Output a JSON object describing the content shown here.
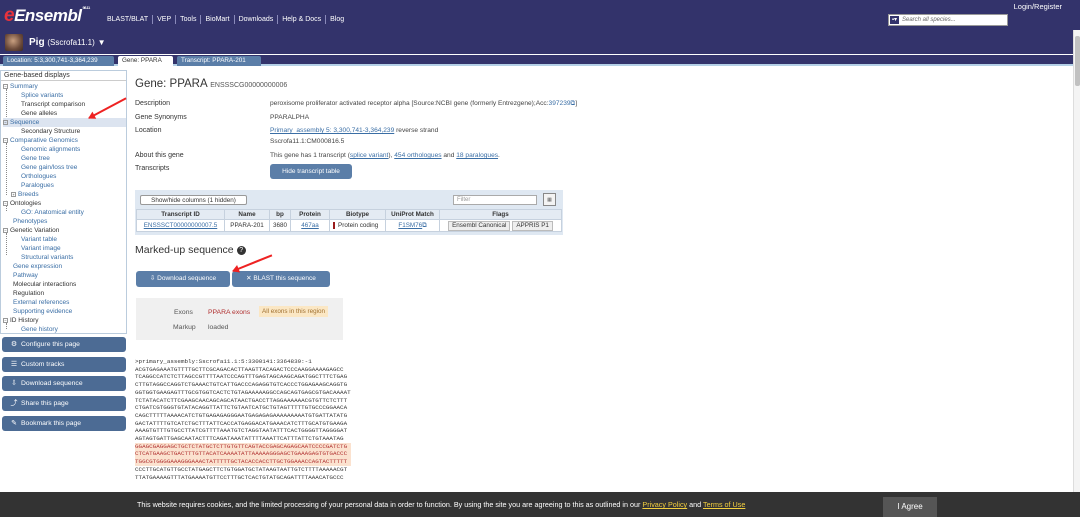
{
  "header": {
    "logo": "Ensembl",
    "logo_sup": "98.11",
    "nav": [
      "BLAST/BLAT",
      "VEP",
      "Tools",
      "BioMart",
      "Downloads",
      "Help & Docs",
      "Blog"
    ],
    "login": "Login/Register",
    "search_placeholder": "Search all species..."
  },
  "species": {
    "name": "Pig",
    "assembly": "(Sscrofa11.1)",
    "caret": "▼"
  },
  "tabs": [
    "Location: 5:3,300,741-3,364,239",
    "Gene: PPARA",
    "Transcript: PPARA-201"
  ],
  "sidebar": {
    "title": "Gene-based displays",
    "items": [
      "Summary",
      "Splice variants",
      "Transcript comparison",
      "Gene alleles",
      "Sequence",
      "Secondary Structure",
      "Comparative Genomics",
      "Genomic alignments",
      "Gene tree",
      "Gene gain/loss tree",
      "Orthologues",
      "Paralogues",
      "Breeds",
      "Ontologies",
      "GO: Anatomical entity",
      "Phenotypes",
      "Genetic Variation",
      "Variant table",
      "Variant image",
      "Structural variants",
      "Gene expression",
      "Pathway",
      "Molecular interactions",
      "Regulation",
      "External references",
      "Supporting evidence",
      "ID History",
      "Gene history"
    ],
    "buttons": [
      "Configure this page",
      "Custom tracks",
      "Download sequence",
      "Share this page",
      "Bookmark this page"
    ]
  },
  "gene": {
    "title": "Gene: PPARA",
    "id": "ENSSSCG00000000006",
    "labels": [
      "Description",
      "Gene Synonyms",
      "Location",
      "About this gene",
      "Transcripts"
    ],
    "description": "peroxisome proliferator activated receptor alpha [Source:NCBI gene (formerly Entrezgene);Acc:",
    "description_acc": "397239",
    "description_end": "]",
    "synonyms": "PPARALPHA",
    "location_link": "Primary_assembly 5: 3,300,741-3,364,239",
    "location_strand": " reverse strand",
    "location_line2": "Sscrofa11.1:CM000816.5",
    "about_prefix": "This gene has 1 transcript (",
    "about_splice": "splice variant",
    "about_mid": "), ",
    "about_orthologues": "454 orthologues",
    "about_and": " and ",
    "about_paralogues": "18 paralogues",
    "about_end": ".",
    "hide_transcripts": "Hide transcript table"
  },
  "transcript_table": {
    "show_hide": "Show/hide columns (1 hidden)",
    "filter_placeholder": "Filter",
    "headers": [
      "Transcript ID",
      "Name",
      "bp",
      "Protein",
      "Biotype",
      "UniProt Match",
      "Flags"
    ],
    "row": {
      "id": "ENSSSCT00000000007.5",
      "name": "PPARA-201",
      "bp": "3680",
      "protein": "467aa",
      "biotype": "Protein coding",
      "uniprot": "F1SM76",
      "flags": [
        "Ensembl Canonical",
        "APPRIS P1"
      ]
    }
  },
  "markup": {
    "heading": "Marked-up sequence",
    "download_btn": "Download sequence",
    "blast_btn": "BLAST this sequence",
    "exons_label": "Exons",
    "exons_val": "PPARA exons",
    "exons_all": "All exons in this region",
    "markup_label": "Markup",
    "markup_val": "loaded"
  },
  "sequence": {
    "header": ">primary_assembly:Sscrofa11.1:5:3300141:3364839:-1",
    "lines": [
      "ACGTGAGAAATGTTTTGCTTCGCAGACACTTAAGTTACAGACTCCCAAGGAAAAGAGCC",
      "TCAGGCCATCTCTTAGCCGTTTTAATCCCAGTTTGAGTAGCAAGCAGATGGCTTTCTGAG",
      "CTTGTAGGCCAGGTCTGAAACTGTCATTGACCCAGAGGTGTCACCCTGGAGAAGCAGGTG",
      "GGTGGTGAAGAGTTTGCGTGGTCACTCTGTAGAAAAAGGCCAGCAGTGAGCGTGACAAAAT",
      "TCTATACATCTTCGAAGCAACAGCAGCATAACTGACCTTAGGAAAAAACGTGTTCTCTTT",
      "CTGATCGTGGGTGTATACAGGTTATTCTGTAATCATGCTGTAGTTTTTGTGCCCGGAACA",
      "CAGCTTTTTAAAACATCTGTGAGAGAGGGAATGAGAGAGAAAAAAAAATGTGATTATATG",
      "GACTATTTTGTCATCTGCTTTATTCACCATGAGGACATGAAACATCTTTGCATGTGAAGA",
      "AAAGTGTTTGTGCCTTATCGTTTTAAATGTCTAGGTAATATTTCACTGGGGTTAGGGGAT",
      "AGTAGTGATTGAGCAATACTTTCAGATAAATATTTTAAATTCATTTATTCTGTAAATAG",
      "GGAGCGAGGAGCTGCTCTATGCTCTTGTGTTCAGTACCGAGCAGAGCAATCCCCGATCTG",
      "CTCATGAAGCTGACTTTGTTACATCAAAATATTAAAAAGGGAGCTGAAAGAGTGTGACCC",
      "TGGCGTGGGGAAAGGGAAACTATTTTTGCTACACCACCTTGCTGGAAACCAGTACTTTTT",
      "CCCTTGCATGTTGCCTATGAGCTTCTGTGGATGCTATAAGTAATTGTCTTTTAAAAACGT",
      "TTATGAAAAGTTTATGAAAATGTTCCTTTGCTCACTGTATGCAGATTTTAAACATGCCC"
    ]
  },
  "cookie": {
    "text": "This website requires cookies, and the limited processing of your personal data in order to function. By using the site you are agreeing to this as outlined in our ",
    "privacy": "Privacy Policy",
    "and": " and ",
    "terms": "Terms of Use",
    "agree": "I Agree"
  }
}
